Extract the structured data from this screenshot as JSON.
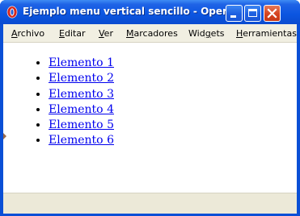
{
  "window": {
    "title": "Ejemplo menu vertical sencillo - Opera"
  },
  "menubar": {
    "items": [
      {
        "first": "A",
        "rest": "rchivo"
      },
      {
        "first": "E",
        "rest": "ditar"
      },
      {
        "first": "V",
        "rest": "er"
      },
      {
        "first": "M",
        "rest": "arcadores"
      },
      {
        "prefix": "Wid",
        "first": "g",
        "rest": "ets"
      },
      {
        "first": "H",
        "rest": "erramientas"
      }
    ]
  },
  "content": {
    "links": [
      "Elemento 1",
      "Elemento 2",
      "Elemento 3",
      "Elemento 4",
      "Elemento 5",
      "Elemento 6"
    ]
  },
  "colors": {
    "titlebar": "#0b55e0",
    "link": "#0000ee",
    "menubar_bg": "#f1efe2",
    "close_button": "#d5431f"
  },
  "icons": {
    "app": "opera-icon",
    "minimize": "minimize-icon",
    "maximize": "maximize-icon",
    "close": "close-icon"
  }
}
